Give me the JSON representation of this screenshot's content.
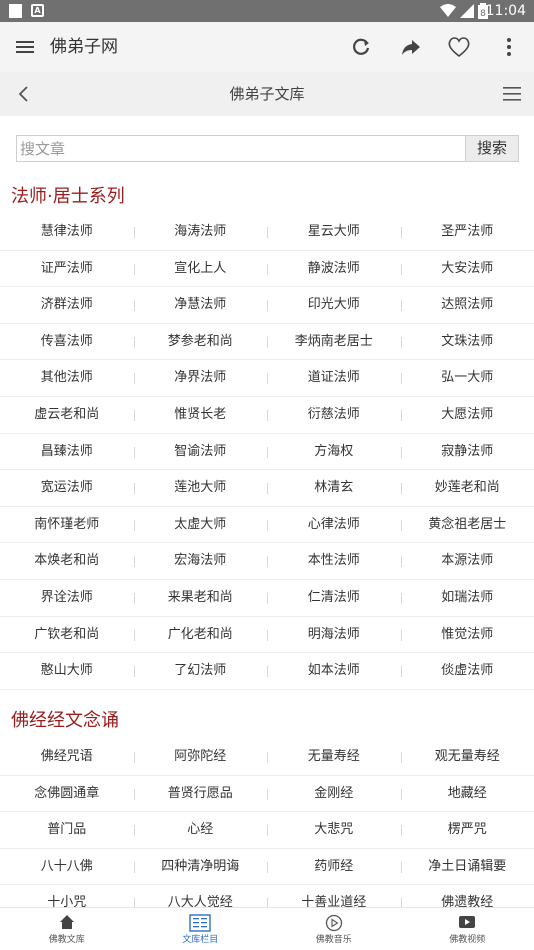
{
  "status_bar": {
    "time": "11:04",
    "battery": "8"
  },
  "app_bar": {
    "title": "佛弟子网",
    "icons": [
      "menu-icon",
      "refresh-icon",
      "share-icon",
      "heart-icon",
      "more-icon"
    ]
  },
  "sub_bar": {
    "title": "佛弟子文库",
    "icons": [
      "back-icon",
      "list-icon"
    ]
  },
  "search": {
    "placeholder": "搜文章",
    "value": "",
    "button_label": "搜索"
  },
  "sections": [
    {
      "title": "法师·居士系列",
      "rows": [
        [
          "慧律法师",
          "海涛法师",
          "星云大师",
          "圣严法师"
        ],
        [
          "证严法师",
          "宣化上人",
          "静波法师",
          "大安法师"
        ],
        [
          "济群法师",
          "净慧法师",
          "印光大师",
          "达照法师"
        ],
        [
          "传喜法师",
          "梦参老和尚",
          "李炳南老居士",
          "文珠法师"
        ],
        [
          "其他法师",
          "净界法师",
          "道证法师",
          "弘一大师"
        ],
        [
          "虚云老和尚",
          "惟贤长老",
          "衍慈法师",
          "大愿法师"
        ],
        [
          "昌臻法师",
          "智谕法师",
          "方海权",
          "寂静法师"
        ],
        [
          "宽运法师",
          "莲池大师",
          "林清玄",
          "妙莲老和尚"
        ],
        [
          "南怀瑾老师",
          "太虚大师",
          "心律法师",
          "黄念祖老居士"
        ],
        [
          "本焕老和尚",
          "宏海法师",
          "本性法师",
          "本源法师"
        ],
        [
          "界诠法师",
          "来果老和尚",
          "仁清法师",
          "如瑞法师"
        ],
        [
          "广钦老和尚",
          "广化老和尚",
          "明海法师",
          "惟觉法师"
        ],
        [
          "憨山大师",
          "了幻法师",
          "如本法师",
          "倓虚法师"
        ]
      ]
    },
    {
      "title": "佛经经文念诵",
      "rows": [
        [
          "佛经咒语",
          "阿弥陀经",
          "无量寿经",
          "观无量寿经"
        ],
        [
          "念佛圆通章",
          "普贤行愿品",
          "金刚经",
          "地藏经"
        ],
        [
          "普门品",
          "心经",
          "大悲咒",
          "楞严咒"
        ],
        [
          "八十八佛",
          "四种清净明诲",
          "药师经",
          "净土日诵辑要"
        ],
        [
          "十小咒",
          "八大人觉经",
          "十善业道经",
          "佛遗教经"
        ]
      ]
    }
  ],
  "bottom_nav": [
    {
      "label": "佛教文库",
      "icon": "home-icon",
      "active": false
    },
    {
      "label": "文库栏目",
      "icon": "columns-icon",
      "active": true
    },
    {
      "label": "佛教音乐",
      "icon": "play-circle-icon",
      "active": false
    },
    {
      "label": "佛教视频",
      "icon": "video-icon",
      "active": false
    }
  ],
  "colors": {
    "section_title": "#9b1c1c",
    "active_nav": "#2c6fc3",
    "status_bar": "#707070"
  }
}
